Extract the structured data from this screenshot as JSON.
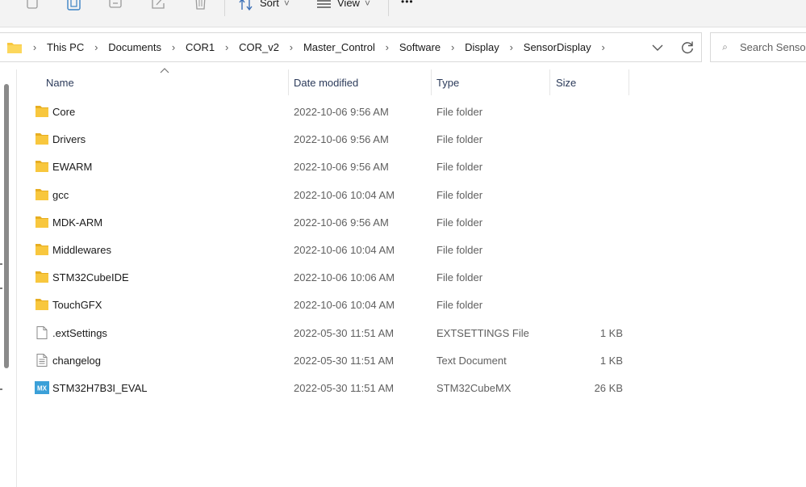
{
  "toolbar": {
    "sort_label": "Sort",
    "view_label": "View",
    "more_label": "•••",
    "chevron": "˅",
    "icons": [
      "copy-icon",
      "paste-icon",
      "rename-icon",
      "share-icon",
      "delete-icon",
      "sort-icon",
      "view-icon"
    ]
  },
  "address": {
    "separator": "›",
    "crumbs": [
      "This PC",
      "Documents",
      "COR1",
      "COR_v2",
      "Master_Control",
      "Software",
      "Display",
      "SensorDisplay"
    ]
  },
  "search": {
    "placeholder": "Search Sensor"
  },
  "columns": {
    "name": "Name",
    "date": "Date modified",
    "type": "Type",
    "size": "Size"
  },
  "files": [
    {
      "name": "Core",
      "date": "2022-10-06 9:56 AM",
      "type": "File folder",
      "size": "",
      "icon": "folder-icon"
    },
    {
      "name": "Drivers",
      "date": "2022-10-06 9:56 AM",
      "type": "File folder",
      "size": "",
      "icon": "folder-icon"
    },
    {
      "name": "EWARM",
      "date": "2022-10-06 9:56 AM",
      "type": "File folder",
      "size": "",
      "icon": "folder-icon"
    },
    {
      "name": "gcc",
      "date": "2022-10-06 10:04 AM",
      "type": "File folder",
      "size": "",
      "icon": "folder-icon"
    },
    {
      "name": "MDK-ARM",
      "date": "2022-10-06 9:56 AM",
      "type": "File folder",
      "size": "",
      "icon": "folder-icon"
    },
    {
      "name": "Middlewares",
      "date": "2022-10-06 10:04 AM",
      "type": "File folder",
      "size": "",
      "icon": "folder-icon"
    },
    {
      "name": "STM32CubeIDE",
      "date": "2022-10-06 10:06 AM",
      "type": "File folder",
      "size": "",
      "icon": "folder-icon"
    },
    {
      "name": "TouchGFX",
      "date": "2022-10-06 10:04 AM",
      "type": "File folder",
      "size": "",
      "icon": "folder-icon"
    },
    {
      "name": ".extSettings",
      "date": "2022-05-30 11:51 AM",
      "type": "EXTSETTINGS File",
      "size": "1 KB",
      "icon": "blank-file-icon"
    },
    {
      "name": "changelog",
      "date": "2022-05-30 11:51 AM",
      "type": "Text Document",
      "size": "1 KB",
      "icon": "text-file-icon"
    },
    {
      "name": "STM32H7B3I_EVAL",
      "date": "2022-05-30 11:51 AM",
      "type": "STM32CubeMX",
      "size": "26 KB",
      "icon": "stm32cubemx-file-icon",
      "badge": "MX"
    }
  ],
  "colors": {
    "folder": "#f8c73e",
    "folder_dark": "#e7ae22",
    "accent": "#2b3a5a",
    "mx_badge": "#3ba0d8"
  }
}
